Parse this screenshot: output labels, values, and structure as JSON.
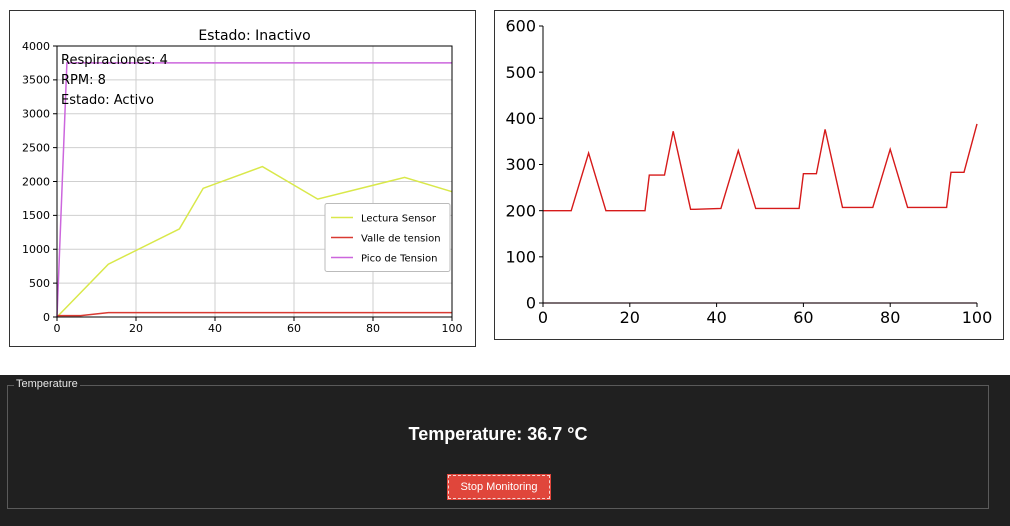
{
  "chart_data": [
    {
      "type": "line",
      "title": "Estado: Inactivo",
      "xlim": [
        0,
        100
      ],
      "ylim": [
        0,
        4000
      ],
      "xticks": [
        0,
        20,
        40,
        60,
        80,
        100
      ],
      "yticks": [
        0,
        500,
        1000,
        1500,
        2000,
        2500,
        3000,
        3500,
        4000
      ],
      "grid": true,
      "legend_position": "center-right",
      "annotations": [
        "Respiraciones: 4",
        "RPM: 8",
        "Estado: Activo"
      ],
      "series": [
        {
          "name": "Lectura Sensor",
          "color": "#d9e84a",
          "x": [
            0,
            13,
            31,
            37,
            52,
            66,
            88,
            100
          ],
          "y": [
            0,
            780,
            1300,
            1900,
            2220,
            1740,
            2060,
            1850
          ]
        },
        {
          "name": "Valle de tension",
          "color": "#d93a32",
          "x": [
            0,
            6,
            13,
            100
          ],
          "y": [
            20,
            20,
            65,
            65
          ]
        },
        {
          "name": "Pico de Tension",
          "color": "#cc66dd",
          "x": [
            0,
            2.5,
            100
          ],
          "y": [
            0,
            3750,
            3750
          ]
        }
      ]
    },
    {
      "type": "line",
      "title": "",
      "xlim": [
        0,
        100
      ],
      "ylim": [
        0,
        600
      ],
      "xticks": [
        0,
        20,
        40,
        60,
        80,
        100
      ],
      "yticks": [
        0,
        100,
        200,
        300,
        400,
        500,
        600
      ],
      "grid": false,
      "series": [
        {
          "color": "#d61a1a",
          "x": [
            0,
            6.5,
            10.5,
            14.5,
            23.5,
            24.5,
            28,
            30,
            34,
            35,
            41,
            45,
            49,
            59,
            60,
            63,
            65,
            69,
            76,
            80,
            84,
            93,
            94,
            97,
            100
          ],
          "y": [
            200,
            200,
            325,
            200,
            200,
            277,
            277,
            372,
            203,
            203,
            205,
            330,
            205,
            205,
            280,
            280,
            376,
            207,
            207,
            333,
            207,
            207,
            283,
            283,
            388
          ]
        },
        {
          "color": "#e8b7c7",
          "x": [
            0,
            100
          ],
          "y": [
            0,
            0
          ]
        }
      ]
    }
  ],
  "temperature_panel": {
    "legend": "Temperature",
    "readout": "Temperature: 36.7 °C",
    "button_label": "Stop Monitoring"
  },
  "colors": {
    "dark_background": "#202020",
    "button": "#e0463b"
  }
}
